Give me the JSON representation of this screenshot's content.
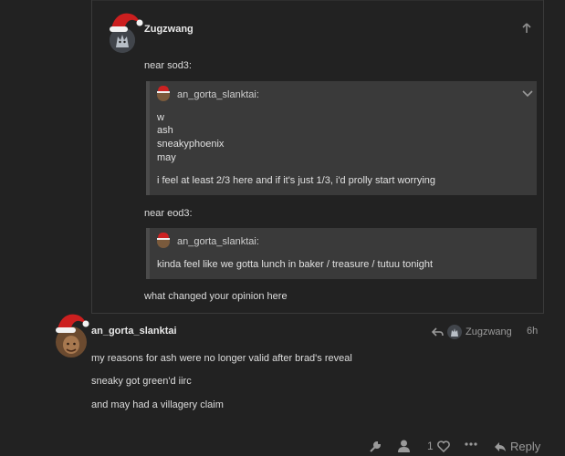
{
  "embedded_post": {
    "username": "Zugzwang",
    "paragraph_1": "near sod3:",
    "quote_1": {
      "username": "an_gorta_slanktai:",
      "lines": [
        "w",
        "ash",
        "sneakyphoenix",
        "may"
      ],
      "last_line": "i feel at least 2/3 here and if it's just 1/3, i'd prolly start worrying"
    },
    "paragraph_2": "near eod3:",
    "quote_2": {
      "username": "an_gorta_slanktai:",
      "line": "kinda feel like we gotta lunch in baker / treasure / tutuu tonight"
    },
    "paragraph_3": "what changed your opinion here"
  },
  "post": {
    "username": "an_gorta_slanktai",
    "reply_to": "Zugzwang",
    "time": "6h",
    "paragraphs": [
      "my reasons for ash were no longer valid after brad's reveal",
      "sneaky got green'd iirc",
      "and may had a villagery claim"
    ],
    "like_count": "1",
    "reply_label": "Reply"
  },
  "icons": {
    "up_arrow": "arrow-up-icon",
    "chevron": "chevron-down-icon",
    "reply_arrow": "reply-arrow-icon",
    "admin": "wrench-icon",
    "user": "user-icon",
    "heart": "heart-icon",
    "more": "ellipsis-icon",
    "reply": "reply-icon"
  }
}
